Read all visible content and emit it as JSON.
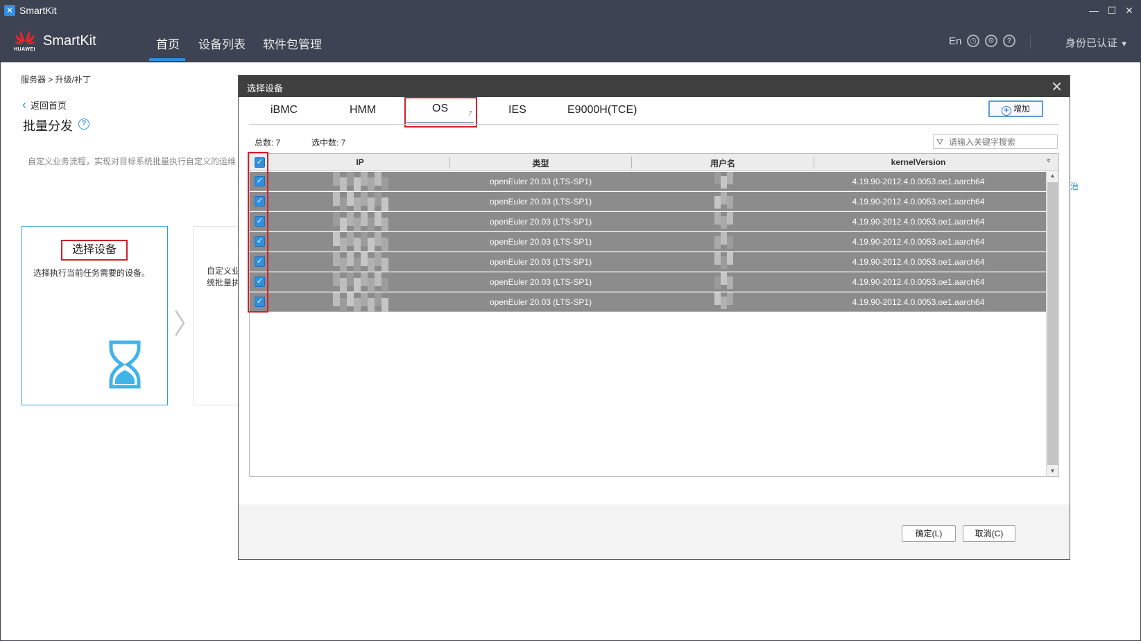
{
  "window": {
    "title": "SmartKit"
  },
  "header": {
    "brand": "SmartKit",
    "logo_word": "HUAWEI",
    "nav": [
      "首页",
      "设备列表",
      "软件包管理"
    ],
    "lang": "En",
    "auth": "身份已认证"
  },
  "page": {
    "breadcrumb": "服务器 > 升级/补丁",
    "back": "返回首页",
    "title": "批量分发",
    "desc": "自定义业务流程，实现对目标系统批量执行自定义的运维",
    "step1_title": "选择设备",
    "step1_desc": "选择执行当前任务需要的设备。",
    "step2_desc_line1": "自定义业",
    "step2_desc_line2": "统批量执",
    "right_link": "治"
  },
  "dialog": {
    "title": "选择设备",
    "tabs": [
      "iBMC",
      "HMM",
      "OS",
      "IES",
      "E9000H(TCE)"
    ],
    "active_tab": "OS",
    "os_count": "7",
    "add_label": "增加",
    "total_label": "总数: 7",
    "selected_label": "选中数: 7",
    "search_placeholder": "请输入关键字搜索",
    "columns": [
      "IP",
      "类型",
      "用户名",
      "kernelVersion"
    ],
    "rows": [
      {
        "type": "openEuler 20.03 (LTS-SP1)",
        "kernel": "4.19.90-2012.4.0.0053.oe1.aarch64"
      },
      {
        "type": "openEuler 20.03 (LTS-SP1)",
        "kernel": "4.19.90-2012.4.0.0053.oe1.aarch64"
      },
      {
        "type": "openEuler 20.03 (LTS-SP1)",
        "kernel": "4.19.90-2012.4.0.0053.oe1.aarch64"
      },
      {
        "type": "openEuler 20.03 (LTS-SP1)",
        "kernel": "4.19.90-2012.4.0.0053.oe1.aarch64"
      },
      {
        "type": "openEuler 20.03 (LTS-SP1)",
        "kernel": "4.19.90-2012.4.0.0053.oe1.aarch64"
      },
      {
        "type": "openEuler 20.03 (LTS-SP1)",
        "kernel": "4.19.90-2012.4.0.0053.oe1.aarch64"
      },
      {
        "type": "openEuler 20.03 (LTS-SP1)",
        "kernel": "4.19.90-2012.4.0.0053.oe1.aarch64"
      }
    ],
    "ok_label": "确定(L)",
    "cancel_label": "取消(C)"
  },
  "colors": {
    "accent": "#2f8fe0",
    "highlight_box": "#d0202a",
    "header_bg": "#3d4352",
    "row_selected": "#8c8c8c"
  }
}
